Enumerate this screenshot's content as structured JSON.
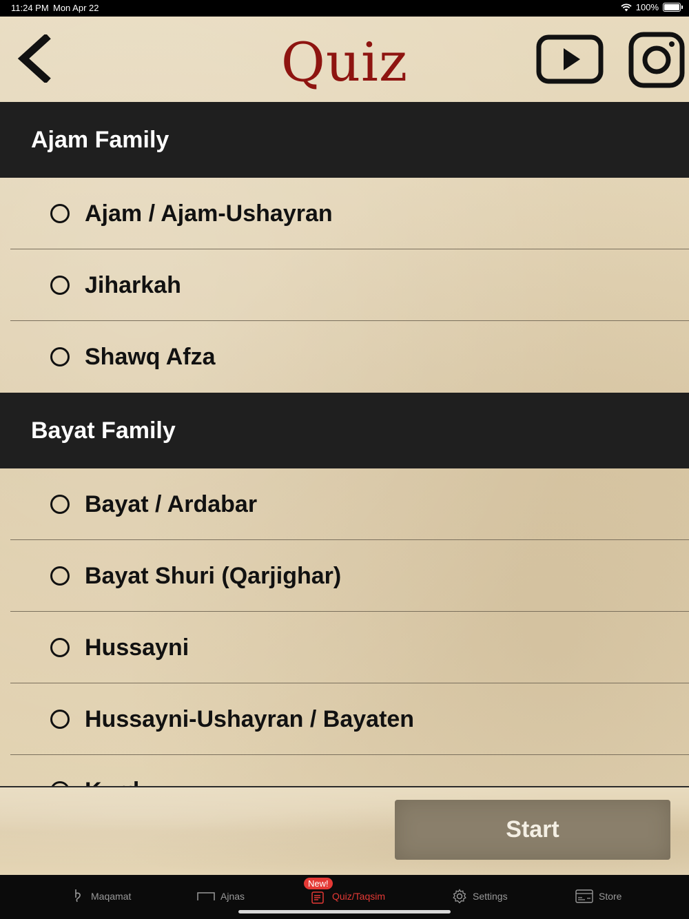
{
  "status_bar": {
    "time": "11:24 PM",
    "date": "Mon Apr 22",
    "battery_text": "100%",
    "icons": [
      "wifi-icon",
      "battery-icon"
    ]
  },
  "header": {
    "title": "Quiz",
    "back_icon": "chevron-left-icon",
    "youtube_icon": "youtube-icon",
    "instagram_icon": "instagram-icon",
    "title_color": "#8e1410"
  },
  "sections": [
    {
      "title": "Ajam Family",
      "items": [
        {
          "label": "Ajam / Ajam-Ushayran"
        },
        {
          "label": "Jiharkah"
        },
        {
          "label": "Shawq Afza"
        }
      ]
    },
    {
      "title": "Bayat Family",
      "items": [
        {
          "label": "Bayat / Ardabar"
        },
        {
          "label": "Bayat Shuri (Qarjighar)"
        },
        {
          "label": "Hussayni"
        },
        {
          "label": "Hussayni-Ushayran / Bayaten"
        },
        {
          "label": "Kurd"
        }
      ]
    }
  ],
  "action": {
    "start_label": "Start"
  },
  "tabbar": {
    "tabs": [
      {
        "label": "Maqamat",
        "icon": "maqam-symbol-icon"
      },
      {
        "label": "Ajnas",
        "icon": "bracket-icon"
      },
      {
        "label": "Quiz/Taqsim",
        "icon": "quiz-icon",
        "active": true
      },
      {
        "label": "Settings",
        "icon": "gear-icon"
      },
      {
        "label": "Store",
        "icon": "store-card-icon"
      }
    ],
    "badge": "New!",
    "active_color": "#e53935",
    "inactive_color": "#9a9a9a"
  }
}
